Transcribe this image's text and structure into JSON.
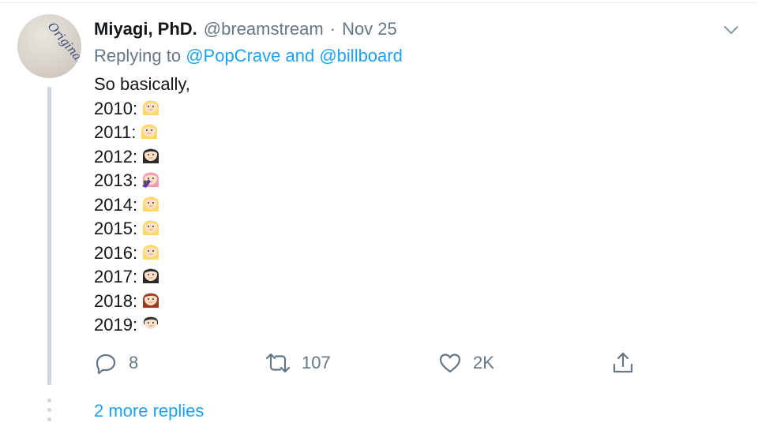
{
  "tweet": {
    "name": "Miyagi, PhD.",
    "handle": "@breamstream",
    "separator": "·",
    "date": "Nov 25",
    "avatar_text": "Original",
    "reply_prefix": "Replying to",
    "mention_1": "@PopCrave",
    "reply_and": "and",
    "mention_2": "@billboard",
    "intro": "So basically,",
    "lines": [
      {
        "year": "2010:",
        "emoji": "blonde-woman"
      },
      {
        "year": "2011:",
        "emoji": "blonde-woman"
      },
      {
        "year": "2012:",
        "emoji": "dark-haired-woman"
      },
      {
        "year": "2013:",
        "emoji": "pink-haired-singer"
      },
      {
        "year": "2014:",
        "emoji": "blonde-woman"
      },
      {
        "year": "2015:",
        "emoji": "blonde-woman"
      },
      {
        "year": "2016:",
        "emoji": "blonde-woman"
      },
      {
        "year": "2017:",
        "emoji": "dark-haired-woman"
      },
      {
        "year": "2018:",
        "emoji": "auburn-haired-woman"
      },
      {
        "year": "2019:",
        "emoji": "dark-haired-woman-short"
      }
    ]
  },
  "actions": {
    "replies": "8",
    "retweets": "107",
    "likes": "2K"
  },
  "more_replies": "2 more replies",
  "colors": {
    "accent": "#1da1f2",
    "muted": "#657786",
    "text": "#14171a",
    "thread": "#cdd6dd"
  }
}
